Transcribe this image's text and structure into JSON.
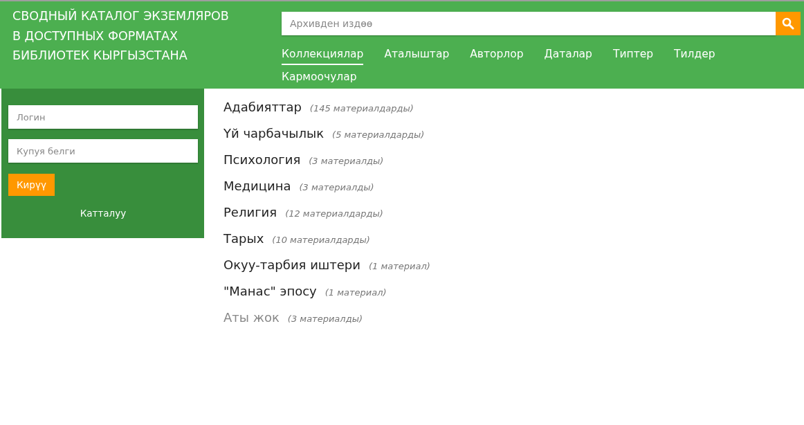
{
  "header": {
    "title_lines": [
      "СВОДНЫЙ КАТАЛОГ ЭКЗЕМЛЯРОВ",
      "В ДОСТУПНЫХ ФОРМАТАХ",
      "БИБЛИОТЕК КЫРГЫЗСТАНА"
    ],
    "search": {
      "placeholder": "Архивден издөө"
    },
    "nav": [
      {
        "label": "Коллекциялар",
        "selected": true
      },
      {
        "label": "Аталыштар",
        "selected": false
      },
      {
        "label": "Авторлор",
        "selected": false
      },
      {
        "label": "Даталар",
        "selected": false
      },
      {
        "label": "Типтер",
        "selected": false
      },
      {
        "label": "Тилдер",
        "selected": false
      },
      {
        "label": "Кармоочулар",
        "selected": false
      }
    ]
  },
  "login": {
    "login_placeholder": "Логин",
    "password_placeholder": "Купуя белги",
    "submit": "Кирүү",
    "register": "Катталуу"
  },
  "collections": [
    {
      "name": "Адабияттар",
      "count": "(145 материалдарды)",
      "muted": false
    },
    {
      "name": "Үй чарбачылык",
      "count": "(5 материалдарды)",
      "muted": false
    },
    {
      "name": "Психология",
      "count": "(3 материалды)",
      "muted": false
    },
    {
      "name": "Медицина",
      "count": "(3 материалды)",
      "muted": false
    },
    {
      "name": "Религия",
      "count": "(12 материалдарды)",
      "muted": false
    },
    {
      "name": "Тарых",
      "count": "(10 материалдарды)",
      "muted": false
    },
    {
      "name": "Окуу-тарбия иштери",
      "count": "(1 материал)",
      "muted": false
    },
    {
      "name": "\"Манас\" эпосу",
      "count": "(1 материал)",
      "muted": false
    },
    {
      "name": "Аты жок",
      "count": "(3 материалды)",
      "muted": true
    }
  ]
}
